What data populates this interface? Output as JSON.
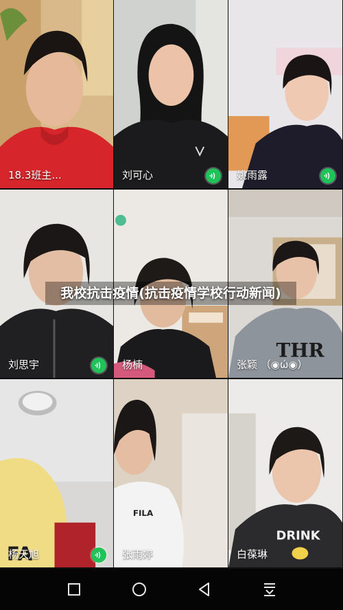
{
  "participants": [
    {
      "name": "18.3班主...",
      "speaking": false
    },
    {
      "name": "刘可心",
      "speaking": true
    },
    {
      "name": "姚雨露",
      "speaking": true
    },
    {
      "name": "刘思宇",
      "speaking": true
    },
    {
      "name": "杨楠",
      "speaking": false
    },
    {
      "name": "张颖 （◉ώ◉）",
      "speaking": false
    },
    {
      "name": "杨天旭",
      "speaking": true
    },
    {
      "name": "张雨婷",
      "speaking": false
    },
    {
      "name": "白葆琳",
      "speaking": false
    }
  ],
  "overlay": {
    "title": "我校抗击疫情(抗击疫情学校行动新闻)"
  },
  "navbar": {
    "icons": [
      "square-recents-icon",
      "circle-home-icon",
      "triangle-back-icon",
      "download-menu-icon"
    ]
  },
  "colors": {
    "speaking_badge": "#1fc35a"
  }
}
